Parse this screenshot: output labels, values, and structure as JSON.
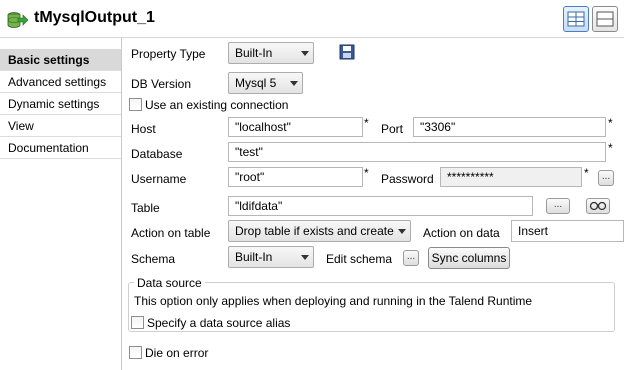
{
  "header": {
    "title": "tMysqlOutput_1",
    "icon": "mysql-output-component-icon"
  },
  "nav": {
    "items": [
      {
        "label": "Basic settings",
        "active": true
      },
      {
        "label": "Advanced settings",
        "active": false
      },
      {
        "label": "Dynamic settings",
        "active": false
      },
      {
        "label": "View",
        "active": false
      },
      {
        "label": "Documentation",
        "active": false
      }
    ]
  },
  "form": {
    "property_type": {
      "label": "Property Type",
      "value": "Built-In"
    },
    "db_version": {
      "label": "DB Version",
      "value": "Mysql 5"
    },
    "use_existing_connection": {
      "label": "Use an existing connection",
      "checked": false
    },
    "host": {
      "label": "Host",
      "value": "\"localhost\""
    },
    "port": {
      "label": "Port",
      "value": "\"3306\""
    },
    "database": {
      "label": "Database",
      "value": "\"test\""
    },
    "username": {
      "label": "Username",
      "value": "\"root\""
    },
    "password": {
      "label": "Password",
      "value": "**********"
    },
    "table": {
      "label": "Table",
      "value": "\"ldifdata\""
    },
    "action_on_table": {
      "label": "Action on table",
      "value": "Drop table if exists and create"
    },
    "action_on_data": {
      "label": "Action on data",
      "value": "Insert"
    },
    "schema": {
      "label": "Schema",
      "value": "Built-In"
    },
    "edit_schema_label": "Edit schema",
    "sync_columns_label": "Sync columns",
    "data_source": {
      "title": "Data source",
      "note": "This option only applies when deploying and running in the Talend Runtime",
      "alias_label": "Specify a data source alias",
      "alias_checked": false
    },
    "die_on_error": {
      "label": "Die on error",
      "checked": false
    },
    "required_marker": "*",
    "ellipsis": "..."
  }
}
